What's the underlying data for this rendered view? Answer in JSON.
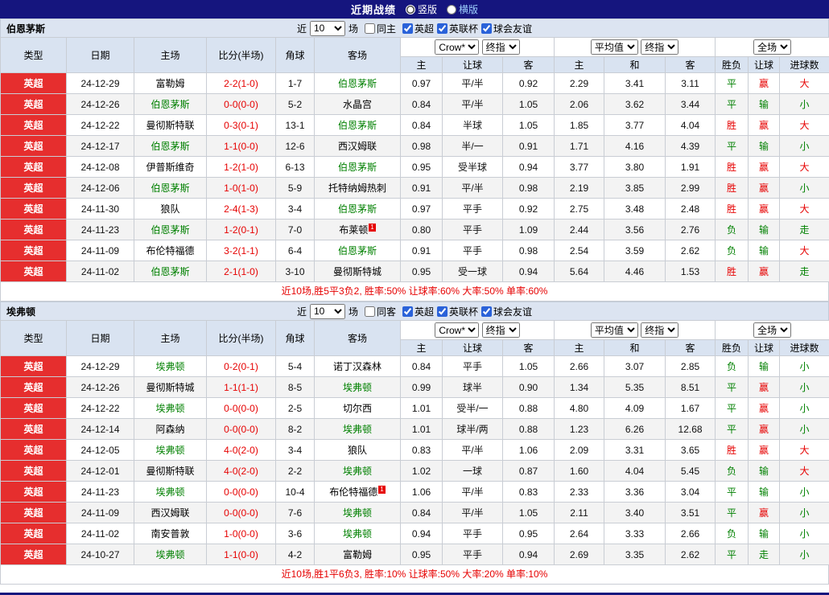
{
  "title_bar": {
    "title": "近期战绩",
    "layout_options": [
      {
        "label": "竖版",
        "selected": true
      },
      {
        "label": "横版",
        "selected": false
      }
    ]
  },
  "filters": {
    "near_label": "近",
    "games_value": "10",
    "games_suffix": "场",
    "leagues": [
      {
        "label": "英超",
        "checked": true
      },
      {
        "label": "英联杯",
        "checked": true
      },
      {
        "label": "球会友谊",
        "checked": true
      }
    ]
  },
  "table_header": {
    "type": "类型",
    "date": "日期",
    "home": "主场",
    "score": "比分(半场)",
    "corner": "角球",
    "away": "客场",
    "odds_select": "Crow*",
    "odds_final": "终指",
    "odds_cols": [
      "主",
      "让球",
      "客"
    ],
    "avg_select": "平均值",
    "avg_final": "终指",
    "avg_cols": [
      "主",
      "和",
      "客"
    ],
    "fulltime_select": "全场",
    "result_cols": [
      "胜负",
      "让球",
      "进球数"
    ]
  },
  "sections": [
    {
      "team": "伯恩茅斯",
      "same_filter": {
        "label": "同主",
        "checked": false
      },
      "rows": [
        {
          "league": "英超",
          "date": "24-12-29",
          "home": "富勒姆",
          "home_focus": false,
          "score": "2-2(1-0)",
          "corner": "1-7",
          "away": "伯恩茅斯",
          "away_focus": true,
          "odds": [
            "0.97",
            "平/半",
            "0.92"
          ],
          "avg": [
            "2.29",
            "3.41",
            "3.11"
          ],
          "result": [
            "平",
            "green"
          ],
          "handicap": [
            "赢",
            "red"
          ],
          "goals": [
            "大",
            "red"
          ]
        },
        {
          "league": "英超",
          "date": "24-12-26",
          "home": "伯恩茅斯",
          "home_focus": true,
          "score": "0-0(0-0)",
          "corner": "5-2",
          "away": "水晶宫",
          "away_focus": false,
          "odds": [
            "0.84",
            "平/半",
            "1.05"
          ],
          "avg": [
            "2.06",
            "3.62",
            "3.44"
          ],
          "result": [
            "平",
            "green"
          ],
          "handicap": [
            "输",
            "green"
          ],
          "goals": [
            "小",
            "green"
          ]
        },
        {
          "league": "英超",
          "date": "24-12-22",
          "home": "曼彻斯特联",
          "home_focus": false,
          "score": "0-3(0-1)",
          "corner": "13-1",
          "away": "伯恩茅斯",
          "away_focus": true,
          "odds": [
            "0.84",
            "半球",
            "1.05"
          ],
          "avg": [
            "1.85",
            "3.77",
            "4.04"
          ],
          "result": [
            "胜",
            "red"
          ],
          "handicap": [
            "赢",
            "red"
          ],
          "goals": [
            "大",
            "red"
          ]
        },
        {
          "league": "英超",
          "date": "24-12-17",
          "home": "伯恩茅斯",
          "home_focus": true,
          "score": "1-1(0-0)",
          "corner": "12-6",
          "away": "西汉姆联",
          "away_focus": false,
          "odds": [
            "0.98",
            "半/一",
            "0.91"
          ],
          "avg": [
            "1.71",
            "4.16",
            "4.39"
          ],
          "result": [
            "平",
            "green"
          ],
          "handicap": [
            "输",
            "green"
          ],
          "goals": [
            "小",
            "green"
          ]
        },
        {
          "league": "英超",
          "date": "24-12-08",
          "home": "伊普斯维奇",
          "home_focus": false,
          "score": "1-2(1-0)",
          "corner": "6-13",
          "away": "伯恩茅斯",
          "away_focus": true,
          "odds": [
            "0.95",
            "受半球",
            "0.94"
          ],
          "avg": [
            "3.77",
            "3.80",
            "1.91"
          ],
          "result": [
            "胜",
            "red"
          ],
          "handicap": [
            "赢",
            "red"
          ],
          "goals": [
            "大",
            "red"
          ]
        },
        {
          "league": "英超",
          "date": "24-12-06",
          "home": "伯恩茅斯",
          "home_focus": true,
          "score": "1-0(1-0)",
          "corner": "5-9",
          "away": "托特纳姆热刺",
          "away_focus": false,
          "odds": [
            "0.91",
            "平/半",
            "0.98"
          ],
          "avg": [
            "2.19",
            "3.85",
            "2.99"
          ],
          "result": [
            "胜",
            "red"
          ],
          "handicap": [
            "赢",
            "red"
          ],
          "goals": [
            "小",
            "green"
          ]
        },
        {
          "league": "英超",
          "date": "24-11-30",
          "home": "狼队",
          "home_focus": false,
          "score": "2-4(1-3)",
          "corner": "3-4",
          "away": "伯恩茅斯",
          "away_focus": true,
          "odds": [
            "0.97",
            "平手",
            "0.92"
          ],
          "avg": [
            "2.75",
            "3.48",
            "2.48"
          ],
          "result": [
            "胜",
            "red"
          ],
          "handicap": [
            "赢",
            "red"
          ],
          "goals": [
            "大",
            "red"
          ]
        },
        {
          "league": "英超",
          "date": "24-11-23",
          "home": "伯恩茅斯",
          "home_focus": true,
          "score": "1-2(0-1)",
          "corner": "7-0",
          "away": "布莱顿",
          "away_focus": false,
          "away_card": "1",
          "odds": [
            "0.80",
            "平手",
            "1.09"
          ],
          "avg": [
            "2.44",
            "3.56",
            "2.76"
          ],
          "result": [
            "负",
            "green"
          ],
          "handicap": [
            "输",
            "green"
          ],
          "goals": [
            "走",
            "green"
          ]
        },
        {
          "league": "英超",
          "date": "24-11-09",
          "home": "布伦特福德",
          "home_focus": false,
          "score": "3-2(1-1)",
          "corner": "6-4",
          "away": "伯恩茅斯",
          "away_focus": true,
          "odds": [
            "0.91",
            "平手",
            "0.98"
          ],
          "avg": [
            "2.54",
            "3.59",
            "2.62"
          ],
          "result": [
            "负",
            "green"
          ],
          "handicap": [
            "输",
            "green"
          ],
          "goals": [
            "大",
            "red"
          ]
        },
        {
          "league": "英超",
          "date": "24-11-02",
          "home": "伯恩茅斯",
          "home_focus": true,
          "score": "2-1(1-0)",
          "corner": "3-10",
          "away": "曼彻斯特城",
          "away_focus": false,
          "odds": [
            "0.95",
            "受一球",
            "0.94"
          ],
          "avg": [
            "5.64",
            "4.46",
            "1.53"
          ],
          "result": [
            "胜",
            "red"
          ],
          "handicap": [
            "赢",
            "red"
          ],
          "goals": [
            "走",
            "green"
          ]
        }
      ],
      "summary": "近10场,胜5平3负2, 胜率:50% 让球率:60% 大率:50% 单率:60%"
    },
    {
      "team": "埃弗顿",
      "same_filter": {
        "label": "同客",
        "checked": false
      },
      "rows": [
        {
          "league": "英超",
          "date": "24-12-29",
          "home": "埃弗顿",
          "home_focus": true,
          "score": "0-2(0-1)",
          "corner": "5-4",
          "away": "诺丁汉森林",
          "away_focus": false,
          "odds": [
            "0.84",
            "平手",
            "1.05"
          ],
          "avg": [
            "2.66",
            "3.07",
            "2.85"
          ],
          "result": [
            "负",
            "green"
          ],
          "handicap": [
            "输",
            "green"
          ],
          "goals": [
            "小",
            "green"
          ]
        },
        {
          "league": "英超",
          "date": "24-12-26",
          "home": "曼彻斯特城",
          "home_focus": false,
          "score": "1-1(1-1)",
          "corner": "8-5",
          "away": "埃弗顿",
          "away_focus": true,
          "odds": [
            "0.99",
            "球半",
            "0.90"
          ],
          "avg": [
            "1.34",
            "5.35",
            "8.51"
          ],
          "result": [
            "平",
            "green"
          ],
          "handicap": [
            "赢",
            "red"
          ],
          "goals": [
            "小",
            "green"
          ]
        },
        {
          "league": "英超",
          "date": "24-12-22",
          "home": "埃弗顿",
          "home_focus": true,
          "score": "0-0(0-0)",
          "corner": "2-5",
          "away": "切尔西",
          "away_focus": false,
          "odds": [
            "1.01",
            "受半/一",
            "0.88"
          ],
          "avg": [
            "4.80",
            "4.09",
            "1.67"
          ],
          "result": [
            "平",
            "green"
          ],
          "handicap": [
            "赢",
            "red"
          ],
          "goals": [
            "小",
            "green"
          ]
        },
        {
          "league": "英超",
          "date": "24-12-14",
          "home": "阿森纳",
          "home_focus": false,
          "score": "0-0(0-0)",
          "corner": "8-2",
          "away": "埃弗顿",
          "away_focus": true,
          "odds": [
            "1.01",
            "球半/两",
            "0.88"
          ],
          "avg": [
            "1.23",
            "6.26",
            "12.68"
          ],
          "result": [
            "平",
            "green"
          ],
          "handicap": [
            "赢",
            "red"
          ],
          "goals": [
            "小",
            "green"
          ]
        },
        {
          "league": "英超",
          "date": "24-12-05",
          "home": "埃弗顿",
          "home_focus": true,
          "score": "4-0(2-0)",
          "corner": "3-4",
          "away": "狼队",
          "away_focus": false,
          "odds": [
            "0.83",
            "平/半",
            "1.06"
          ],
          "avg": [
            "2.09",
            "3.31",
            "3.65"
          ],
          "result": [
            "胜",
            "red"
          ],
          "handicap": [
            "赢",
            "red"
          ],
          "goals": [
            "大",
            "red"
          ]
        },
        {
          "league": "英超",
          "date": "24-12-01",
          "home": "曼彻斯特联",
          "home_focus": false,
          "score": "4-0(2-0)",
          "corner": "2-2",
          "away": "埃弗顿",
          "away_focus": true,
          "odds": [
            "1.02",
            "一球",
            "0.87"
          ],
          "avg": [
            "1.60",
            "4.04",
            "5.45"
          ],
          "result": [
            "负",
            "green"
          ],
          "handicap": [
            "输",
            "green"
          ],
          "goals": [
            "大",
            "red"
          ]
        },
        {
          "league": "英超",
          "date": "24-11-23",
          "home": "埃弗顿",
          "home_focus": true,
          "score": "0-0(0-0)",
          "corner": "10-4",
          "away": "布伦特福德",
          "away_focus": false,
          "away_card": "1",
          "odds": [
            "1.06",
            "平/半",
            "0.83"
          ],
          "avg": [
            "2.33",
            "3.36",
            "3.04"
          ],
          "result": [
            "平",
            "green"
          ],
          "handicap": [
            "输",
            "green"
          ],
          "goals": [
            "小",
            "green"
          ]
        },
        {
          "league": "英超",
          "date": "24-11-09",
          "home": "西汉姆联",
          "home_focus": false,
          "score": "0-0(0-0)",
          "corner": "7-6",
          "away": "埃弗顿",
          "away_focus": true,
          "odds": [
            "0.84",
            "平/半",
            "1.05"
          ],
          "avg": [
            "2.11",
            "3.40",
            "3.51"
          ],
          "result": [
            "平",
            "green"
          ],
          "handicap": [
            "赢",
            "red"
          ],
          "goals": [
            "小",
            "green"
          ]
        },
        {
          "league": "英超",
          "date": "24-11-02",
          "home": "南安普敦",
          "home_focus": false,
          "score": "1-0(0-0)",
          "corner": "3-6",
          "away": "埃弗顿",
          "away_focus": true,
          "odds": [
            "0.94",
            "平手",
            "0.95"
          ],
          "avg": [
            "2.64",
            "3.33",
            "2.66"
          ],
          "result": [
            "负",
            "green"
          ],
          "handicap": [
            "输",
            "green"
          ],
          "goals": [
            "小",
            "green"
          ]
        },
        {
          "league": "英超",
          "date": "24-10-27",
          "home": "埃弗顿",
          "home_focus": true,
          "score": "1-1(0-0)",
          "corner": "4-2",
          "away": "富勒姆",
          "away_focus": false,
          "odds": [
            "0.95",
            "平手",
            "0.94"
          ],
          "avg": [
            "2.69",
            "3.35",
            "2.62"
          ],
          "result": [
            "平",
            "green"
          ],
          "handicap": [
            "走",
            "green"
          ],
          "goals": [
            "小",
            "green"
          ]
        }
      ],
      "summary": "近10场,胜1平6负3, 胜率:10% 让球率:50% 大率:20% 单率:10%"
    }
  ]
}
